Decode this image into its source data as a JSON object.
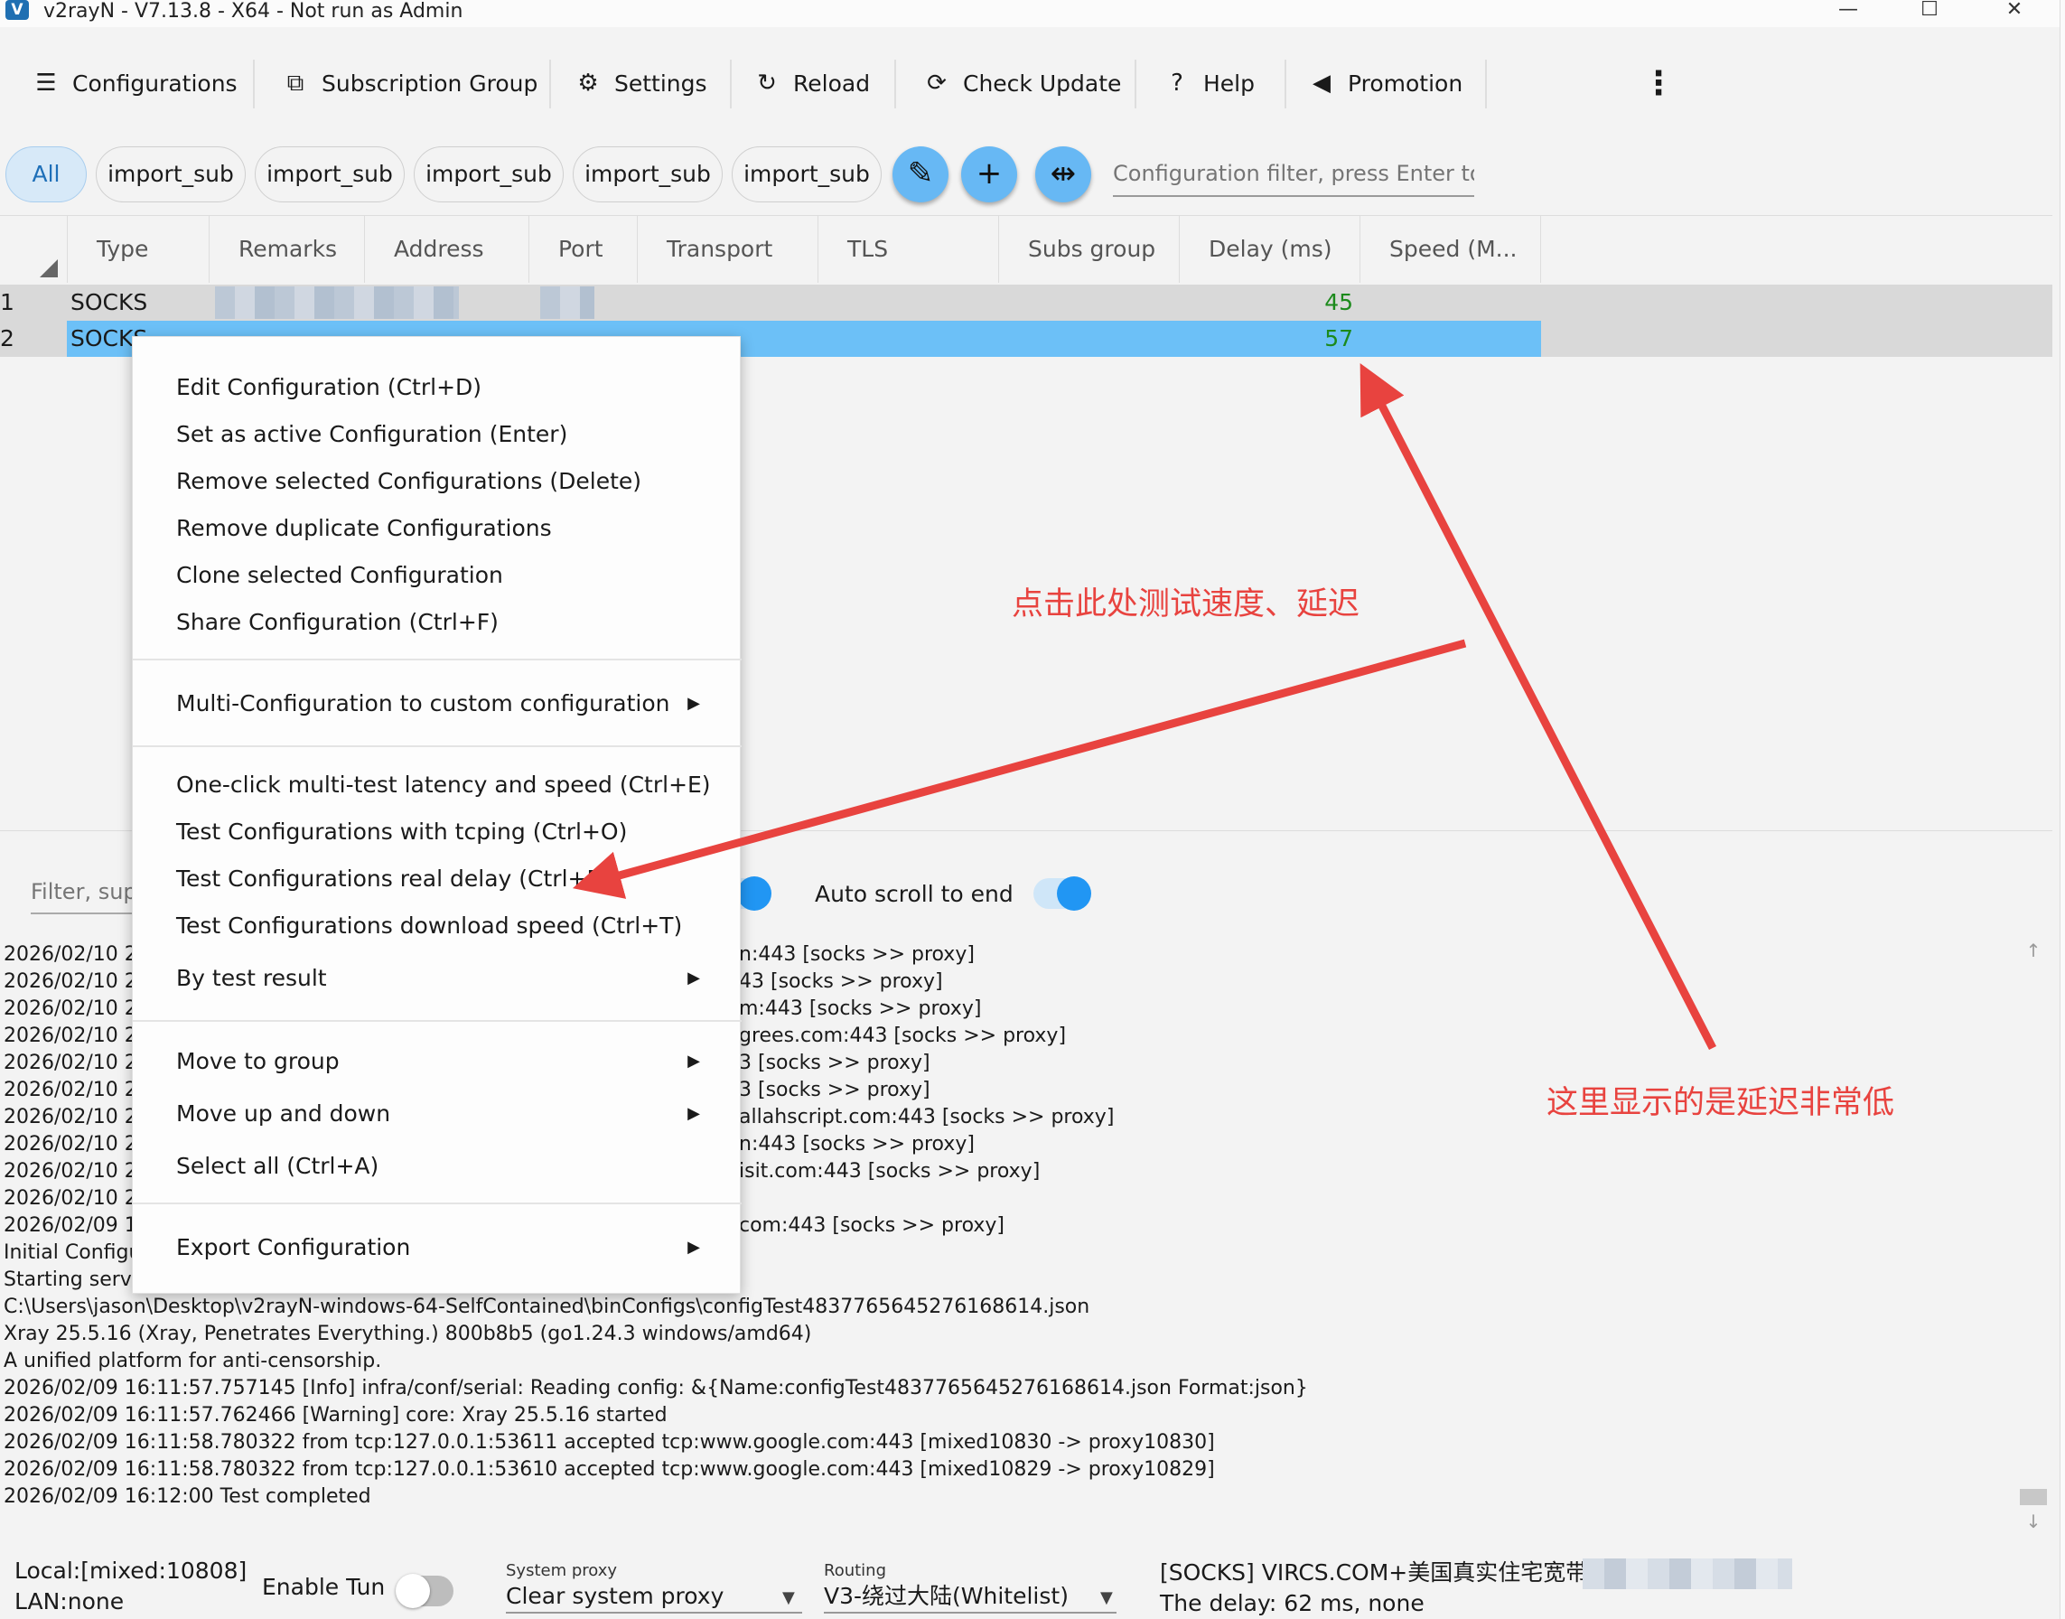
{
  "window": {
    "title": "v2rayN - V7.13.8 - X64 - Not run as Admin",
    "icon_letter": "V",
    "minimize": "—",
    "maximize": "☐",
    "close": "✕"
  },
  "toolbar": {
    "configurations": "Configurations",
    "subscription_group": "Subscription Group",
    "settings": "Settings",
    "reload": "Reload",
    "check_update": "Check Update",
    "help": "Help",
    "promotion": "Promotion",
    "more": "⋮"
  },
  "chips": {
    "all": "All",
    "items": [
      "import_sub",
      "import_sub",
      "import_sub",
      "import_sub",
      "import_sub"
    ]
  },
  "filter": {
    "placeholder": "Configuration filter, press Enter to e"
  },
  "grid": {
    "columns": [
      "Type",
      "Remarks",
      "Address",
      "Port",
      "Transport",
      "TLS",
      "Subs group",
      "Delay (ms)",
      "Speed (M..."
    ],
    "rows": [
      {
        "num": "1",
        "type": "SOCKS",
        "delay": "45"
      },
      {
        "num": "2",
        "type": "SOCKS",
        "delay": "57"
      }
    ]
  },
  "context_menu": {
    "edit": "Edit Configuration (Ctrl+D)",
    "set_active": "Set as active Configuration (Enter)",
    "remove_selected": "Remove selected Configurations (Delete)",
    "remove_duplicate": "Remove duplicate Configurations",
    "clone": "Clone selected Configuration",
    "share": "Share Configuration (Ctrl+F)",
    "multi_custom": "Multi-Configuration to custom configuration",
    "one_click": "One-click multi-test latency and speed (Ctrl+E)",
    "tcping": "Test Configurations with tcping (Ctrl+O)",
    "real_delay": "Test Configurations real delay (Ctrl+R)",
    "download_speed": "Test Configurations download speed (Ctrl+T)",
    "by_test_result": "By test result",
    "move_to_group": "Move to group",
    "move_up_down": "Move up and down",
    "select_all": "Select all (Ctrl+A)",
    "export": "Export Configuration",
    "submenu_caret": "▶"
  },
  "log_tools": {
    "filter_placeholder": "Filter, sup",
    "auto_scroll": "Auto scroll to end"
  },
  "log": {
    "partial_prefixes": [
      "2026/02/10 2",
      "2026/02/10 2",
      "2026/02/10 2",
      "2026/02/10 2",
      "2026/02/10 2",
      "2026/02/10 2",
      "2026/02/10 2",
      "2026/02/10 2",
      "2026/02/10 2",
      "2026/02/10 2",
      "2026/02/09 1",
      "Initial Configu",
      "Starting servi"
    ],
    "partial_suffixes": [
      "n:443 [socks >> proxy]",
      "43 [socks >> proxy]",
      "m:443 [socks >> proxy]",
      "grees.com:443 [socks >> proxy]",
      "3 [socks >> proxy]",
      "3 [socks >> proxy]",
      "allahscript.com:443 [socks >> proxy]",
      "n:443 [socks >> proxy]",
      "isit.com:443 [socks >> proxy]",
      "",
      "com:443 [socks >> proxy]",
      "",
      ""
    ],
    "full_lines": [
      "C:\\Users\\jason\\Desktop\\v2rayN-windows-64-SelfContained\\binConfigs\\configTest4837765645276168614.json",
      "Xray 25.5.16 (Xray, Penetrates Everything.) 800b8b5 (go1.24.3 windows/amd64)",
      "A unified platform for anti-censorship.",
      "2026/02/09 16:11:57.757145 [Info] infra/conf/serial: Reading config: &{Name:configTest4837765645276168614.json Format:json}",
      "2026/02/09 16:11:57.762466 [Warning] core: Xray 25.5.16 started",
      "2026/02/09 16:11:58.780322 from tcp:127.0.0.1:53611 accepted tcp:www.google.com:443 [mixed10830 -> proxy10830]",
      "2026/02/09 16:11:58.780322 from tcp:127.0.0.1:53610 accepted tcp:www.google.com:443 [mixed10829 -> proxy10829]",
      "2026/02/09 16:12:00 Test completed"
    ]
  },
  "status": {
    "local": "Local:[mixed:10808]",
    "lan": "LAN:none",
    "enable_tun": "Enable Tun",
    "system_proxy_label": "System proxy",
    "system_proxy_value": "Clear system proxy",
    "routing_label": "Routing",
    "routing_value": "V3-绕过大陆(Whitelist)",
    "server": "[SOCKS] VIRCS.COM+美国真实住宅宽带-1",
    "delay": "The delay: 62 ms, none"
  },
  "annotations": {
    "speed_note": "点击此处测试速度、延迟",
    "delay_note": "这里显示的是延迟非常低",
    "color": "#e8433f"
  }
}
